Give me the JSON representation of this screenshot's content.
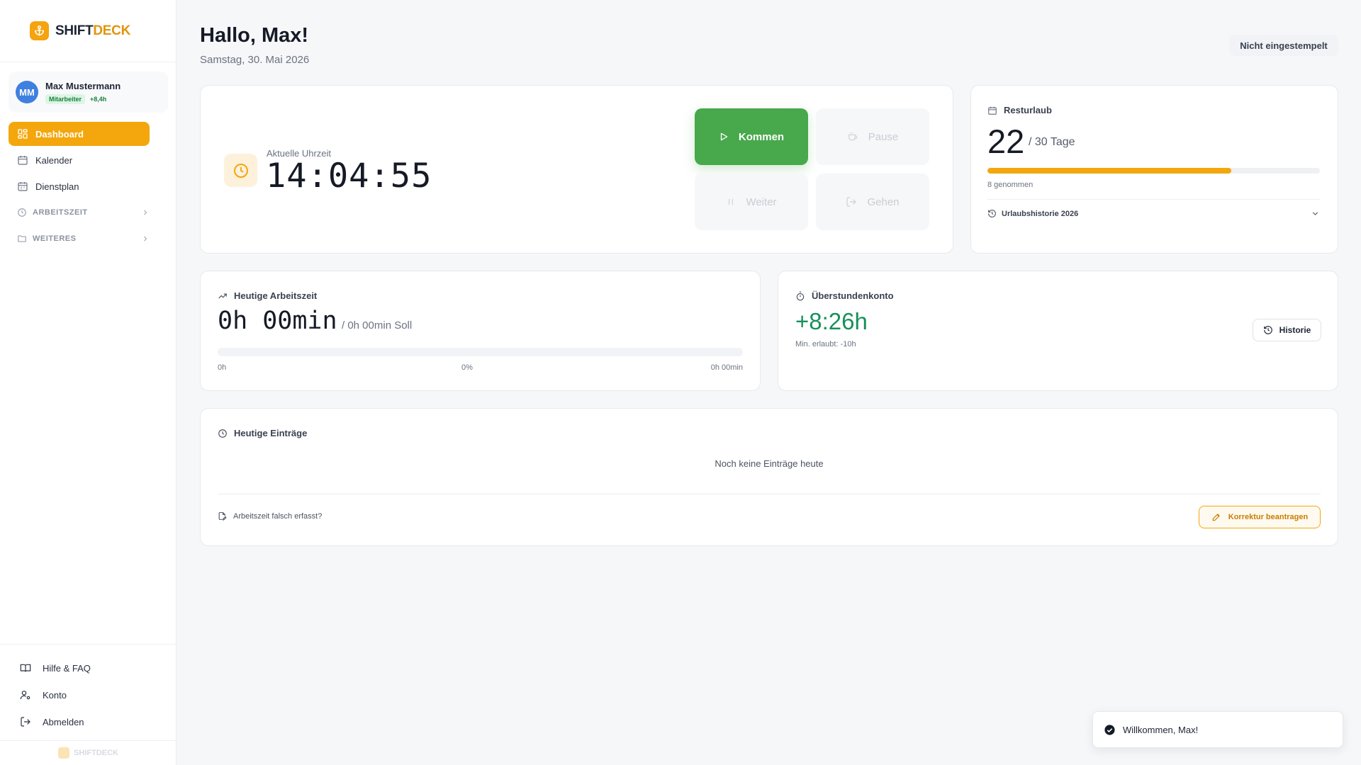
{
  "brand": {
    "part1": "SHIFT",
    "part2": "DECK"
  },
  "user": {
    "initials": "MM",
    "name": "Max Mustermann",
    "role": "Mitarbeiter",
    "balance": "+8,4h"
  },
  "nav": {
    "items": [
      {
        "label": "Dashboard",
        "icon": "grid-icon",
        "active": true
      },
      {
        "label": "Kalender",
        "icon": "calendar-icon",
        "active": false
      },
      {
        "label": "Dienstplan",
        "icon": "calendar-icon",
        "active": false
      }
    ],
    "sections": [
      {
        "label": "ARBEITSZEIT",
        "icon": "clock-icon"
      },
      {
        "label": "WEITERES",
        "icon": "folder-icon"
      }
    ]
  },
  "bottom_nav": [
    {
      "label": "Hilfe & FAQ",
      "icon": "book-icon"
    },
    {
      "label": "Konto",
      "icon": "user-gear-icon"
    },
    {
      "label": "Abmelden",
      "icon": "logout-icon"
    }
  ],
  "footer_brand": "SHIFTDECK",
  "header": {
    "greeting": "Hallo, Max!",
    "date": "Samstag, 30. Mai 2026",
    "status": "Nicht eingestempelt"
  },
  "clock": {
    "label": "Aktuelle Uhrzeit",
    "time": "14:04:55",
    "buttons": {
      "kommen": "Kommen",
      "pause": "Pause",
      "weiter": "Weiter",
      "gehen": "Gehen"
    }
  },
  "vacation": {
    "title": "Resturlaub",
    "remaining": "22",
    "total_label": "/ 30 Tage",
    "taken_fraction": 0.733,
    "taken_label": "8 genommen",
    "history_label": "Urlaubshistorie 2026"
  },
  "work_today": {
    "title": "Heutige Arbeitszeit",
    "value": "0h 00min",
    "soll": "/ 0h 00min Soll",
    "progress_fraction": 0,
    "label_start": "0h",
    "label_mid": "0%",
    "label_end": "0h 00min"
  },
  "overtime": {
    "title": "Überstundenkonto",
    "value": "+8:26h",
    "min_allowed": "Min. erlaubt: -10h",
    "history_button": "Historie"
  },
  "entries": {
    "title": "Heutige Einträge",
    "empty": "Noch keine Einträge heute",
    "wrong_time": "Arbeitszeit falsch erfasst?",
    "correction_button": "Korrektur beantragen"
  },
  "toast": {
    "message": "Willkommen, Max!"
  },
  "colors": {
    "accent": "#f3a70d",
    "success": "#48a84c",
    "overtime": "#16915a",
    "avatar": "#3f7fe0"
  }
}
